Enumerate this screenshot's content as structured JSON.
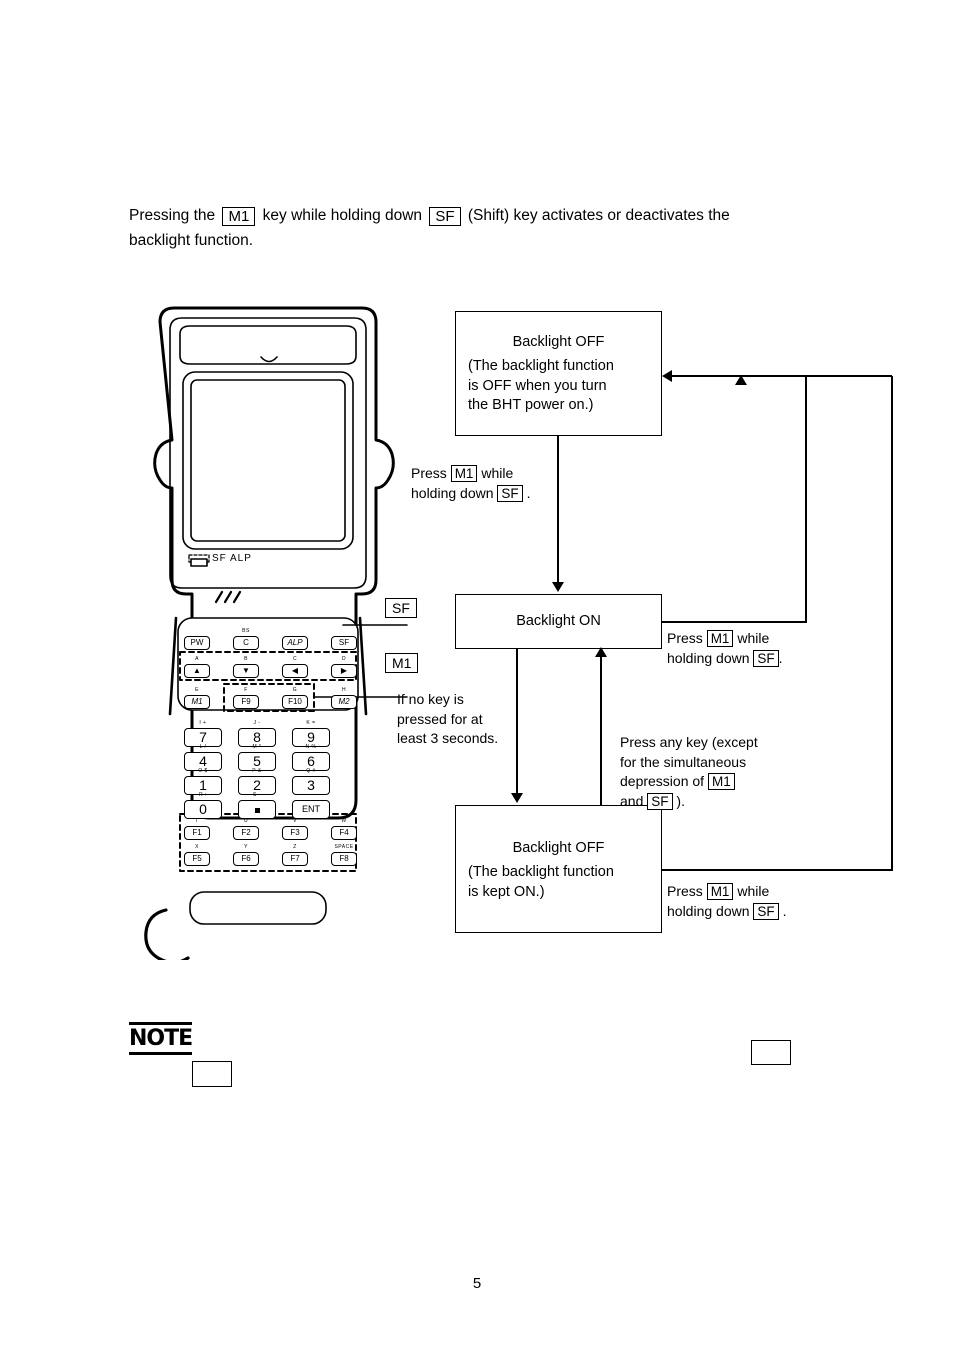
{
  "page": {
    "number": "5"
  },
  "intro": {
    "line1_a": "Pressing the",
    "key_m1": "M1",
    "line1_b": "key while holding down",
    "key_sf": "SF",
    "line1_c": "(Shift) key activates or deactivates the",
    "line2": "backlight function."
  },
  "flow": {
    "box_off_power": {
      "title": "Backlight OFF",
      "detail_line1": "(The backlight function",
      "detail_line2": "is OFF when you turn",
      "detail_line3": "the BHT power on.)"
    },
    "box_on": {
      "title": "Backlight ON"
    },
    "box_off_kept": {
      "title": "Backlight OFF",
      "detail_line1": "(The backlight function",
      "detail_line2": "is kept ON.)"
    },
    "label_press_top": {
      "press": "Press",
      "key1": "M1",
      "while": "while",
      "holding": "holding down",
      "key2": "SF",
      "period": "."
    },
    "label_press_right_mid": {
      "press": "Press",
      "key1": "M1",
      "while": "while",
      "holding": "holding down",
      "key2": "SF",
      "period": "."
    },
    "label_press_right_bottom": {
      "press": "Press",
      "key1": "M1",
      "while": "while",
      "holding": "holding down",
      "key2": "SF",
      "period": "."
    },
    "label_timeout": {
      "line1": "If no key is",
      "line2": "pressed for at",
      "line3": "least 3 seconds."
    },
    "label_anykey": {
      "line1": "Press any key (except",
      "line2": "for the simultaneous",
      "line3_a": "depression of",
      "key1": "M1",
      "line4_a": "and",
      "key2": "SF",
      "line4_b": ")."
    }
  },
  "device": {
    "status_bar": {
      "battery_icon": "battery-icon",
      "indicator_sf": "SF",
      "indicator_alp": "ALP"
    },
    "vent": "///",
    "callouts": [
      {
        "label": "SF"
      },
      {
        "label": "M1"
      }
    ],
    "keys_row_function": [
      {
        "label": "PW",
        "sub": "",
        "italic": false
      },
      {
        "label": "C",
        "sub": "BS",
        "italic": false
      },
      {
        "label": "ALP",
        "sub": "",
        "italic": true
      },
      {
        "label": "SF",
        "sub": "",
        "italic": false
      }
    ],
    "keys_row_arrows": [
      {
        "label": "up-arrow-icon",
        "glyph": "▲",
        "sub": "A"
      },
      {
        "label": "down-arrow-icon",
        "glyph": "▼",
        "sub": "B"
      },
      {
        "label": "left-arrow-icon",
        "glyph": "◀",
        "sub": "C"
      },
      {
        "label": "right-arrow-icon",
        "glyph": "▶",
        "sub": "D"
      }
    ],
    "keys_row_m_f": [
      {
        "label": "M1",
        "sub": "E",
        "italic": true
      },
      {
        "label": "F9",
        "sub": "F",
        "italic": false
      },
      {
        "label": "F10",
        "sub": "G",
        "italic": false
      },
      {
        "label": "M2",
        "sub": "H",
        "italic": true
      }
    ],
    "keypad_numeric": [
      [
        {
          "label": "7",
          "sub": "I  +"
        },
        {
          "label": "8",
          "sub": "J  -"
        },
        {
          "label": "9",
          "sub": "K  ="
        }
      ],
      [
        {
          "label": "4",
          "sub": "L  /"
        },
        {
          "label": "5",
          "sub": "M  *"
        },
        {
          "label": "6",
          "sub": "N  %"
        }
      ],
      [
        {
          "label": "1",
          "sub": "O  $"
        },
        {
          "label": "2",
          "sub": "P  &"
        },
        {
          "label": "3",
          "sub": "Q  #"
        }
      ],
      [
        {
          "label": "0",
          "sub": "R  :"
        },
        {
          "label": ".",
          "sub": "S  -"
        },
        {
          "label": "ENT",
          "sub": ""
        }
      ]
    ],
    "keys_row_f1_f4": [
      {
        "label": "F1",
        "sub": "T"
      },
      {
        "label": "F2",
        "sub": "U"
      },
      {
        "label": "F3",
        "sub": "V"
      },
      {
        "label": "F4",
        "sub": "W"
      }
    ],
    "keys_row_f5_f8": [
      {
        "label": "F5",
        "sub": "X"
      },
      {
        "label": "F6",
        "sub": "Y"
      },
      {
        "label": "F7",
        "sub": "Z"
      },
      {
        "label": "F8",
        "sub": "SPACE"
      }
    ]
  },
  "note": {
    "heading": "NOTE"
  },
  "colors": {
    "ink": "#000000",
    "paper": "#ffffff"
  }
}
